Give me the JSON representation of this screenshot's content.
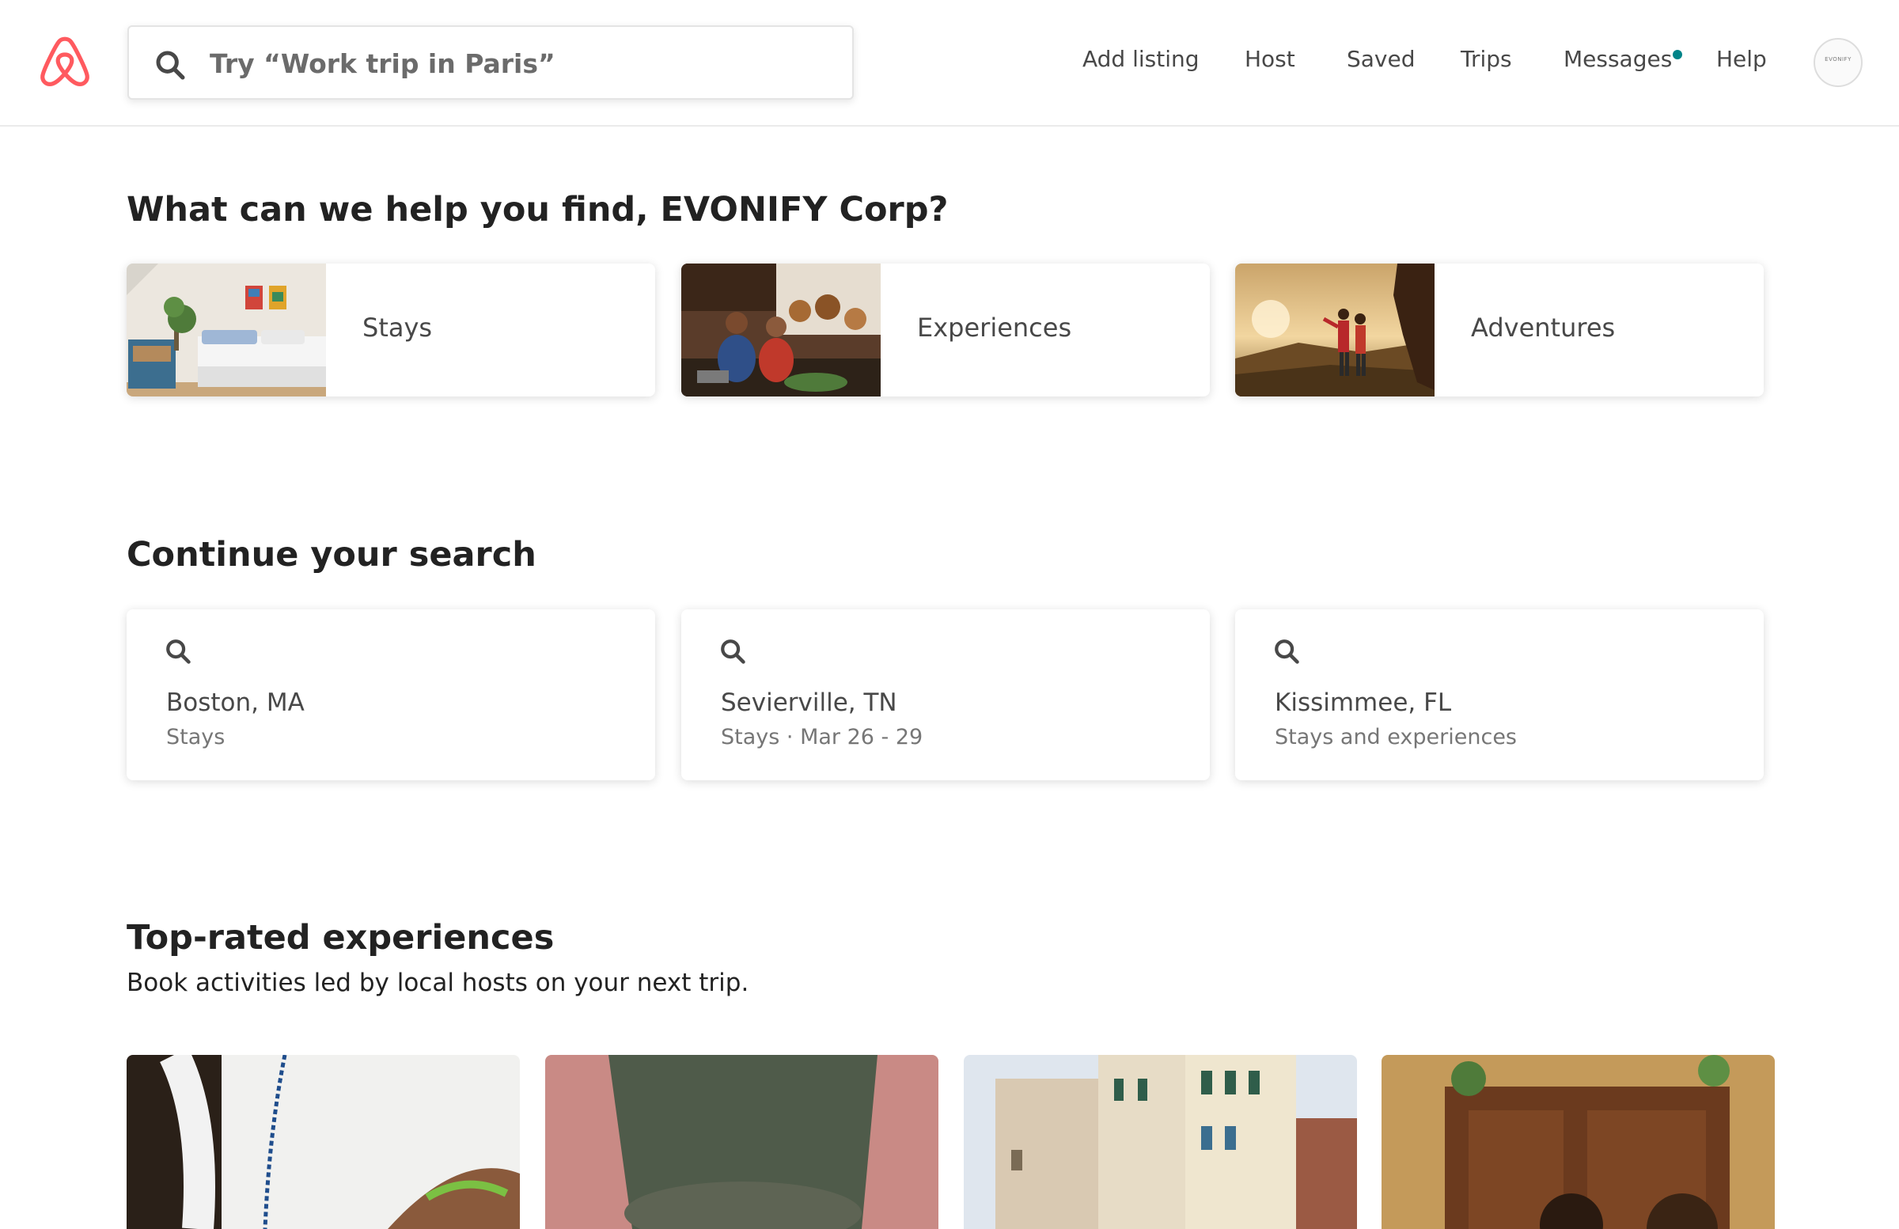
{
  "header": {
    "logo_icon": "airbnb-logo-icon",
    "search": {
      "placeholder": "Try “Work trip in Paris”",
      "icon": "search-icon"
    },
    "nav": [
      {
        "label": "Add listing"
      },
      {
        "label": "Host"
      },
      {
        "label": "Saved"
      },
      {
        "label": "Trips"
      },
      {
        "label": "Messages",
        "has_notification_dot": true
      },
      {
        "label": "Help"
      }
    ],
    "avatar_text": "EVONIFY"
  },
  "help": {
    "title": "What can we help you find, EVONIFY Corp?",
    "categories": [
      {
        "label": "Stays",
        "image": "bedroom-photo"
      },
      {
        "label": "Experiences",
        "image": "cooking-class-photo"
      },
      {
        "label": "Adventures",
        "image": "hikers-sunset-photo"
      }
    ]
  },
  "continue": {
    "title": "Continue your search",
    "items": [
      {
        "place": "Boston, MA",
        "detail": "Stays"
      },
      {
        "place": "Sevierville, TN",
        "detail": "Stays · Mar 26 - 29"
      },
      {
        "place": "Kissimmee, FL",
        "detail": "Stays and experiences"
      }
    ]
  },
  "experiences": {
    "title": "Top-rated experiences",
    "subtitle": "Book activities led by local hosts on your next trip.",
    "cards": [
      {
        "image": "beaded-bracelet-photo"
      },
      {
        "image": "woodworking-photo"
      },
      {
        "image": "venice-buildings-photo"
      },
      {
        "image": "kitchen-group-photo"
      }
    ]
  },
  "colors": {
    "brand": "#FF5A5F",
    "notification": "#008489",
    "text": "#484848",
    "muted": "#767676"
  }
}
